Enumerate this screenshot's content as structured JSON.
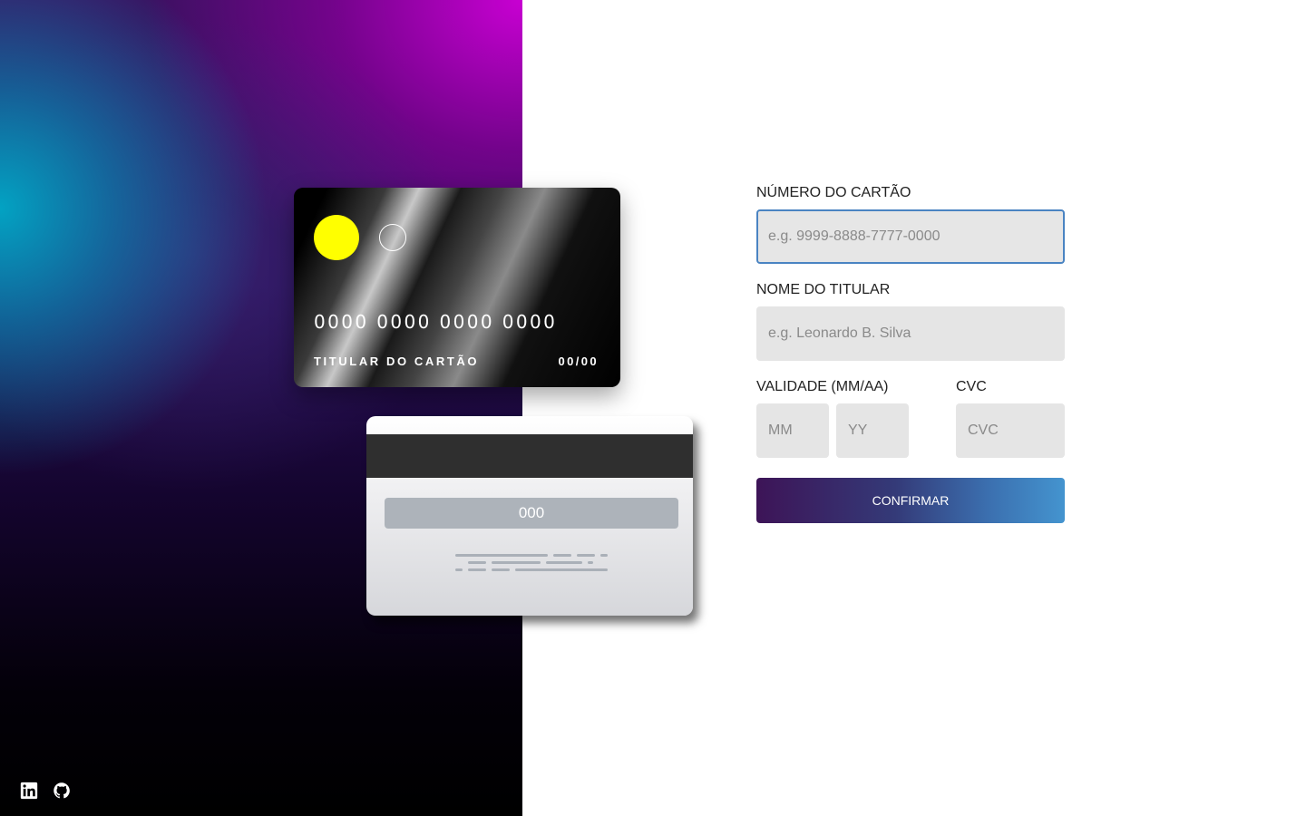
{
  "card_front": {
    "number": "0000 0000 0000 0000",
    "holder": "TITULAR DO CARTÃO",
    "expiry": "00/00"
  },
  "card_back": {
    "cvc": "000"
  },
  "form": {
    "card_number": {
      "label": "NÚMERO DO CARTÃO",
      "placeholder": "e.g. 9999-8888-7777-0000",
      "value": ""
    },
    "holder_name": {
      "label": "NOME DO TITULAR",
      "placeholder": "e.g. Leonardo B. Silva",
      "value": ""
    },
    "expiry": {
      "label": "VALIDADE (MM/AA)",
      "month_placeholder": "MM",
      "year_placeholder": "YY"
    },
    "cvc": {
      "label": "CVC",
      "placeholder": "CVC"
    },
    "submit_label": "CONFIRMAR"
  },
  "social": [
    {
      "icon": "linkedin-icon"
    },
    {
      "icon": "github-icon"
    }
  ],
  "colors": {
    "accent_yellow": "#ffff00",
    "focus_border": "#4a84c2",
    "button_start": "#3d1457",
    "button_end": "#4494cf"
  }
}
